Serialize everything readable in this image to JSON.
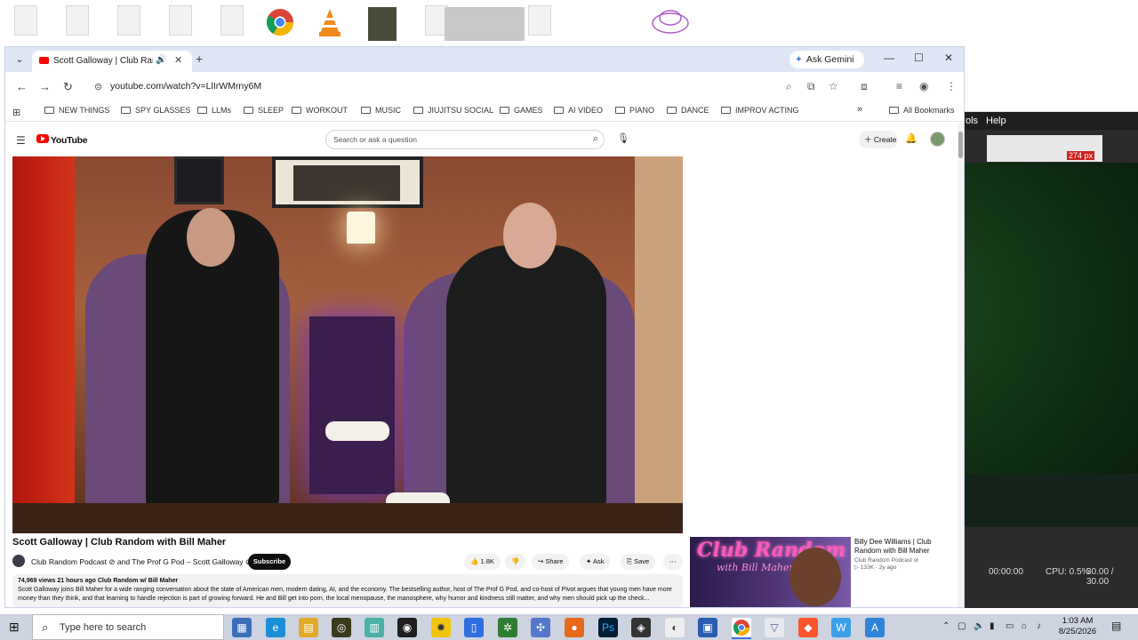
{
  "browser": {
    "tab_title": "Scott Galloway | Club Random",
    "new_tab": "+",
    "ask_gemini": "Ask Gemini",
    "url_prefix": "youtube.com",
    "url": "youtube.com/watch?v=LlIrWMrny6M",
    "window_controls": {
      "minimize": "—",
      "maximize": "☐",
      "close": "✕"
    }
  },
  "bookmarks": [
    {
      "label": "NEW THINGS"
    },
    {
      "label": "SPY GLASSES"
    },
    {
      "label": "LLMs"
    },
    {
      "label": "SLEEP"
    },
    {
      "label": "WORKOUT"
    },
    {
      "label": "MUSIC"
    },
    {
      "label": "JIUJITSU SOCIAL"
    },
    {
      "label": "GAMES"
    },
    {
      "label": "AI VIDEO"
    },
    {
      "label": "PIANO"
    },
    {
      "label": "DANCE"
    },
    {
      "label": "IMPROV ACTING"
    }
  ],
  "all_bookmarks": "All Bookmarks",
  "youtube": {
    "logo_text": "YouTube",
    "search_placeholder": "Search or ask a question",
    "create_label": "Create",
    "video_title": "Scott Galloway | Club Random with Bill Maher",
    "channel_line": "Club Random Podcast ⊘ and The Prof G Pod – Scott Galloway ⊘",
    "subscribe": "Subscribe",
    "likes": "1.8K",
    "share": "Share",
    "ask": "Ask",
    "save": "Save",
    "desc_meta": "74,969 views  21 hours ago  Club Random w/ Bill Maher",
    "desc_text": "Scott Galloway joins Bill Maher for a wide ranging conversation about the state of American men, modern dating, AI, and the economy. The bestselling author, host of The Prof G Pod, and co-host of Pivot argues that young men have more",
    "desc_text2": "money than they think, and that learning to handle rejection is part of growing forward. He and Bill get into porn, the local menopause, the manosphere, why humor and kindness still matter, and why men should pick up the check..."
  },
  "recommendation": {
    "thumb_text": "Club Random",
    "thumb_subtext": "with Bill Maher",
    "title": "Billy Dee Williams | Club Random with Bill Maher",
    "channel": "Club Random Podcast ⊘",
    "meta": "▷ 133K · 2y ago"
  },
  "bgapp": {
    "menu_tools": "ols",
    "menu_help": "Help",
    "time": "00:00:00",
    "cpu": "CPU: 0.5%",
    "fps": "30.00 / 30.00",
    "size_badge": "274 px"
  },
  "taskbar": {
    "search_placeholder": "Type here to search",
    "time": "1:03 AM",
    "date": "8/25/2026"
  }
}
